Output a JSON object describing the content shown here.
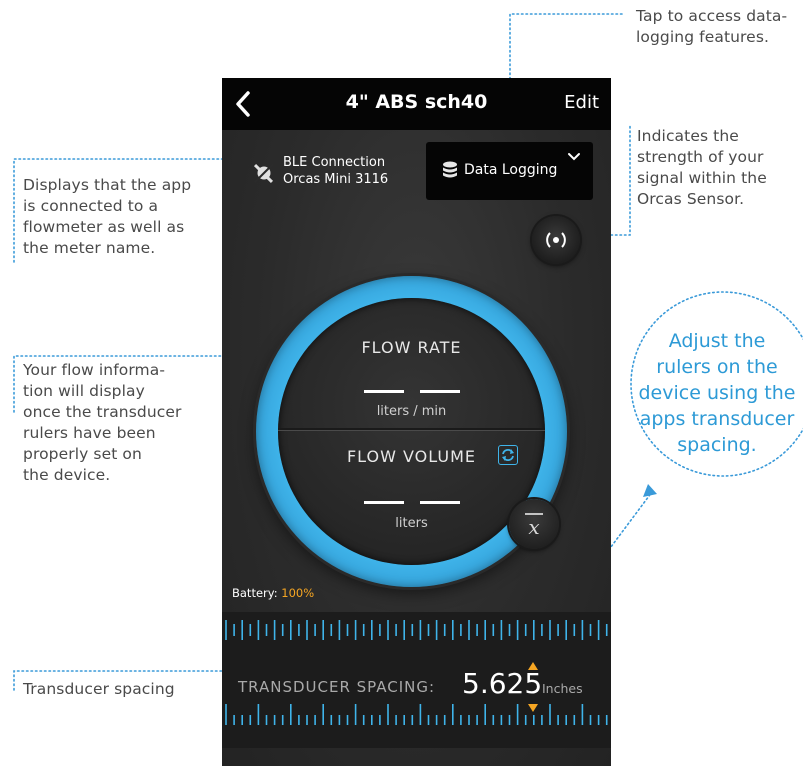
{
  "topbar": {
    "title": "4\" ABS sch40",
    "edit_label": "Edit"
  },
  "ble": {
    "line1": "BLE Connection",
    "line2": "Orcas Mini 3116"
  },
  "data_logging": {
    "label": "Data Logging"
  },
  "gauge": {
    "flow_rate_label": "FLOW  RATE",
    "flow_rate_unit": "liters / min",
    "flow_volume_label": "FLOW  VOLUME",
    "flow_volume_unit": "liters"
  },
  "battery": {
    "label": "Battery:",
    "value": "100%"
  },
  "transducer": {
    "label": "TRANSDUCER SPACING:",
    "value": "5.625",
    "unit": "Inches"
  },
  "annotations": {
    "data_logging": [
      "Tap to access data-",
      "logging features."
    ],
    "signal": [
      "Indicates the",
      "strength of your",
      "signal within the",
      "Orcas Sensor."
    ],
    "ble": [
      "Displays that the app",
      "is connected to a",
      "flowmeter as well as",
      "the meter name."
    ],
    "flow": [
      "Your flow informa-",
      "tion will display",
      "once the transducer",
      "rulers have been",
      "properly set on",
      "the device."
    ],
    "transducer": [
      "Transducer spacing"
    ],
    "rulers": [
      "Adjust the",
      "rulers on the",
      "device using the",
      "apps transducer",
      "spacing."
    ]
  },
  "colors": {
    "accent_blue": "#3fb4ea",
    "battery_orange": "#f6a623",
    "annotation_blue": "#2d9ad6",
    "dotted_line": "#3a9ad9"
  },
  "icons": [
    "back-chevron-icon",
    "ble-disconnected-icon",
    "database-icon",
    "chevron-down-icon",
    "signal-icon",
    "swap-icon",
    "mean-x-bar-icon",
    "arrow-up-icon",
    "arrow-down-icon"
  ]
}
